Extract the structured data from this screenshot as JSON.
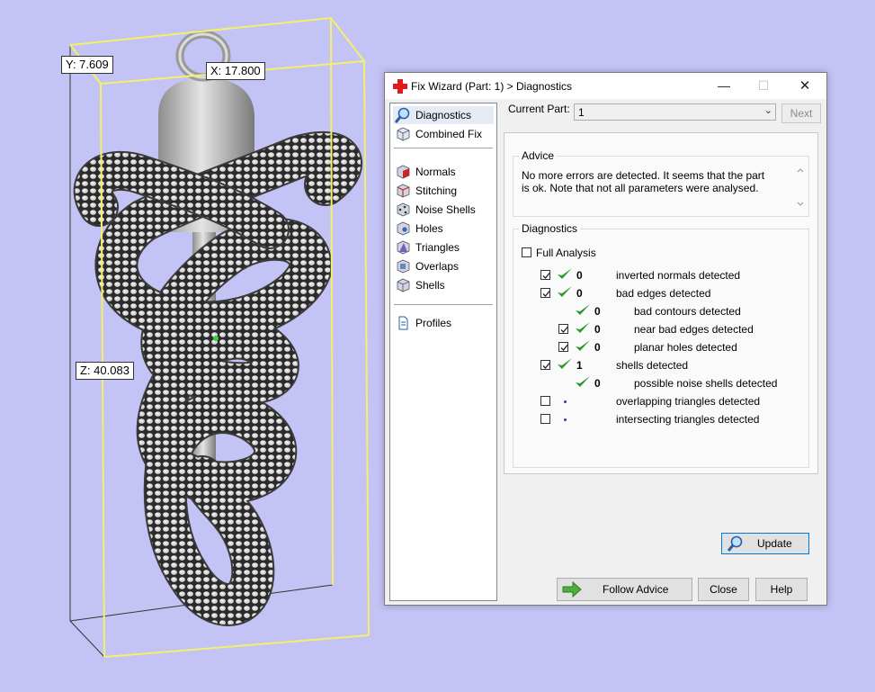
{
  "viewport": {
    "dimensions": {
      "y": "Y: 7.609",
      "x": "X: 17.800",
      "z": "Z: 40.083"
    },
    "bbox_color": "#f5f06a"
  },
  "window": {
    "title": "Fix Wizard (Part: 1) > Diagnostics",
    "title_icon": "red-cross-icon",
    "controls": {
      "minimize": "—",
      "maximize": "☐",
      "close": "✕"
    }
  },
  "nav": {
    "items": [
      {
        "label": "Diagnostics",
        "icon": "magnifier-icon",
        "selected": true
      },
      {
        "label": "Combined Fix",
        "icon": "cube-icon"
      },
      {
        "label": "Normals",
        "icon": "normals-cube-icon"
      },
      {
        "label": "Stitching",
        "icon": "stitching-cube-icon"
      },
      {
        "label": "Noise Shells",
        "icon": "noise-shells-icon"
      },
      {
        "label": "Holes",
        "icon": "holes-icon"
      },
      {
        "label": "Triangles",
        "icon": "triangles-icon"
      },
      {
        "label": "Overlaps",
        "icon": "overlaps-icon"
      },
      {
        "label": "Shells",
        "icon": "shells-icon"
      },
      {
        "label": "Profiles",
        "icon": "document-icon"
      }
    ]
  },
  "current_part": {
    "label": "Current Part:",
    "value": "1",
    "next_label": "Next"
  },
  "advice": {
    "title": "Advice",
    "text": "No more errors are detected. It seems that the part is ok. Note that not all parameters were analysed."
  },
  "diagnostics": {
    "title": "Diagnostics",
    "full_analysis": "Full Analysis",
    "rows": [
      {
        "checkbox": true,
        "checked": true,
        "status": "check",
        "count": "0",
        "text": "inverted normals detected",
        "level": 0
      },
      {
        "checkbox": true,
        "checked": true,
        "status": "check",
        "count": "0",
        "text": "bad edges detected",
        "level": 0
      },
      {
        "checkbox": false,
        "checked": false,
        "status": "check",
        "count": "0",
        "text": "bad contours detected",
        "level": 1
      },
      {
        "checkbox": true,
        "checked": true,
        "status": "check",
        "count": "0",
        "text": "near bad edges detected",
        "level": 1
      },
      {
        "checkbox": true,
        "checked": true,
        "status": "check",
        "count": "0",
        "text": "planar holes detected",
        "level": 1
      },
      {
        "checkbox": true,
        "checked": true,
        "status": "check",
        "count": "1",
        "text": "shells detected",
        "level": 0
      },
      {
        "checkbox": false,
        "checked": false,
        "status": "check",
        "count": "0",
        "text": "possible noise shells detected",
        "level": 1
      },
      {
        "checkbox": true,
        "checked": false,
        "status": "dot",
        "count": "",
        "text": "overlapping triangles detected",
        "level": 0
      },
      {
        "checkbox": true,
        "checked": false,
        "status": "dot",
        "count": "",
        "text": "intersecting triangles detected",
        "level": 0
      }
    ],
    "update_label": "Update"
  },
  "buttons": {
    "follow_advice": "Follow Advice",
    "close": "Close",
    "help": "Help"
  },
  "colors": {
    "check_green": "#2e9a2e",
    "accent": "#0078d7"
  }
}
